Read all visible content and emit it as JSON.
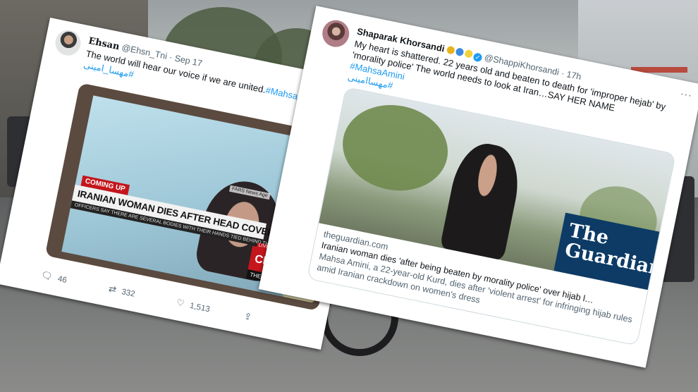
{
  "tweet1": {
    "display_name": "Ehsan",
    "handle": "@Ehsn_Tni",
    "date": "Sep 17",
    "text": "The world will hear our voice if we are united.",
    "hashtag_en": "#Mahsa_Am",
    "hashtag_fa": "#مهسا_امینی",
    "media": {
      "badge": "COMING UP",
      "headline": "IRANIAN WOMAN DIES AFTER HEAD COVER ARREST",
      "ticker": "OFFICERS SAY THERE ARE SEVERAL BODIES WITH THEIR HANDS TIED BEHIND THE",
      "source_tag": "FARS News Age",
      "live": "LIVE",
      "network": "CNN",
      "show": "THE LEAD"
    },
    "replies": "46",
    "retweets": "332",
    "likes": "1,513"
  },
  "tweet2": {
    "display_name": "Shaparak Khorsandi",
    "handle": "@ShappiKhorsandi",
    "date": "17h",
    "text": "My heart is shattered. 22 years old and beaten to death for 'improper hejab' by 'morality police' The world needs to look at Iran…SAY HER NAME",
    "hashtag_en": "#MahsaAmini",
    "hashtag_fa": "#مهسا‌امینی",
    "card": {
      "domain": "theguardian.com",
      "title": "Iranian woman dies 'after being beaten by morality police' over hijab l…",
      "description": "Mahsa Amini, a 22-year-old Kurd, dies after 'violent arrest' for infringing hijab rules amid Iranian crackdown on women's dress",
      "logo_line1": "The",
      "logo_line2": "Guardian"
    }
  },
  "colors": {
    "link": "#1d9bf0",
    "cnn_red": "#c4161c",
    "guardian_blue": "#0d3b66"
  }
}
